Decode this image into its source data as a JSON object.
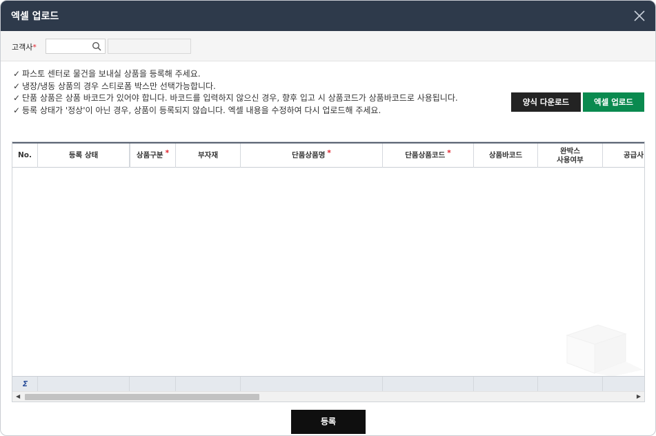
{
  "dialog": {
    "title": "엑셀 업로드"
  },
  "filter": {
    "customer_label": "고객사",
    "required_mark": "*",
    "customer_code_value": "",
    "customer_name_value": ""
  },
  "notes": [
    "파스토 센터로 물건을 보내실 상품을 등록해 주세요.",
    "냉장/냉동 상품의 경우 스티로폼 박스만 선택가능합니다.",
    "단품 상품은 상품 바코드가 있어야 합니다. 바코드를 입력하지 않으신 경우, 향후 입고 시 상품코드가 상품바코드로 사용됩니다.",
    "등록 상태가 '정상'이 아닌 경우, 상품이 등록되지 않습니다. 엑셀 내용을 수정하여 다시 업로드해 주세요."
  ],
  "check_glyph": "✓",
  "buttons": {
    "template_download": "양식 다운로드",
    "excel_upload": "엑셀 업로드",
    "register": "등록"
  },
  "grid": {
    "columns": [
      {
        "label": "No.",
        "required": false
      },
      {
        "label": "등록 상태",
        "required": false
      },
      {
        "label": "상품구분",
        "required": true
      },
      {
        "label": "부자재",
        "required": false
      },
      {
        "label": "단품상품명",
        "required": true
      },
      {
        "label": "단품상품코드",
        "required": true
      },
      {
        "label": "상품바코드",
        "required": false
      },
      {
        "label_line1": "완박스",
        "label_line2": "사용여부",
        "required": false
      },
      {
        "label": "공급사",
        "required": false
      }
    ],
    "rows": [],
    "footer_symbol": "Σ"
  },
  "colors": {
    "titlebar": "#2e3a4b",
    "download_button": "#232323",
    "upload_button": "#0a8a4f",
    "register_button": "#0f0f0f",
    "required": "#e0202a"
  },
  "icons": {
    "close": "close-icon",
    "search": "search-icon",
    "scroll_left": "arrow-left-icon",
    "scroll_right": "arrow-right-icon"
  }
}
